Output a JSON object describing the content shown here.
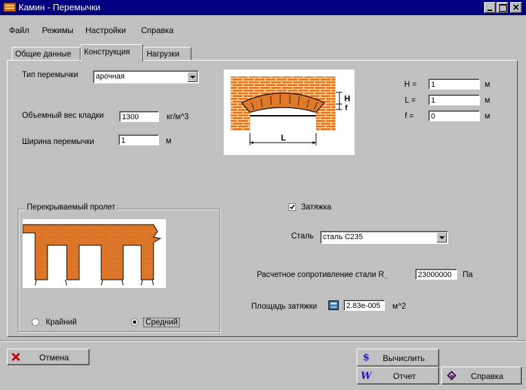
{
  "window": {
    "title": "Камин - Перемычки"
  },
  "menu": [
    "Файл",
    "Режимы",
    "Настройки",
    "Справка"
  ],
  "tabs": [
    "Общие данные",
    "Конструкция",
    "Нагрузки"
  ],
  "form": {
    "lintel_type_label": "Тип перемычки",
    "lintel_type_value": "арочная",
    "volume_weight_label": "Объемный вес кладки",
    "volume_weight_value": "1300",
    "volume_weight_unit": "кг/м^3",
    "width_label": "Ширина перемычки",
    "width_value": "1",
    "width_unit": "м"
  },
  "dims": {
    "H_label": "H =",
    "H_value": "1",
    "H_unit": "м",
    "L_label": "L =",
    "L_value": "1",
    "L_unit": "м",
    "f_label": "f =",
    "f_value": "0",
    "f_unit": "м"
  },
  "diagram": {
    "H": "H",
    "f": "f",
    "L": "L"
  },
  "span": {
    "title": "Перекрываемый пролет",
    "edge_label": "Крайний",
    "middle_label": "Средний",
    "selected": "Средний"
  },
  "tie": {
    "checkbox_label": "Затяжка",
    "checked": true,
    "steel_label": "Сталь",
    "steel_value": "сталь С235",
    "resistance_label": "Расчетное сопротивление стали R",
    "resistance_value": "23000000",
    "resistance_unit": "Па",
    "area_label": "Площадь затяжки",
    "area_value": "2.83е-005",
    "area_unit": "м^2"
  },
  "buttons": {
    "cancel": "Отмена",
    "calculate": "Вычислить",
    "report": "Отчет",
    "help": "Справка"
  },
  "colors": {
    "titlebar": "#000080",
    "brick": "#e07a2a",
    "mortar": "#ffffff"
  }
}
